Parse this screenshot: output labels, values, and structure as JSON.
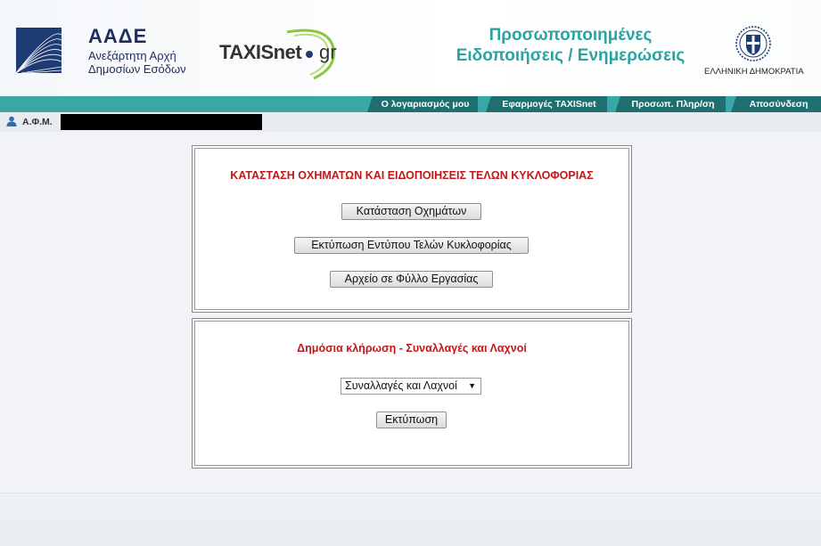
{
  "header": {
    "aade_title": "ΑΑΔΕ",
    "aade_subtitle_line1": "Ανεξάρτητη Αρχή",
    "aade_subtitle_line2": "Δημοσίων Εσόδων",
    "taxisnet_name": "TAXISnet",
    "taxisnet_suffix": "gr",
    "title_line1": "Προσωποποιημένες",
    "title_line2": "Ειδοποιήσεις / Ενημερώσεις",
    "emblem_label": "ΕΛΛΗΝΙΚΗ ΔΗΜΟΚΡΑΤΙΑ",
    "colors": {
      "brand_navy": "#1f3b73",
      "teal": "#2aa3a3",
      "nav_tab": "#1f6e70"
    }
  },
  "nav": {
    "tabs": [
      {
        "label": "Ο λογαριασμός μου"
      },
      {
        "label": "Εφαρμογές TAXISnet"
      },
      {
        "label": "Προσωπ. Πληρ/ση"
      },
      {
        "label": "Αποσύνδεση"
      }
    ]
  },
  "user": {
    "afm_label": "Α.Φ.Μ."
  },
  "vehicles": {
    "title": "ΚΑΤΑΣΤΑΣΗ ΟΧΗΜΑΤΩΝ ΚΑΙ ΕΙΔΟΠΟΙΗΣΕΙΣ ΤΕΛΩΝ ΚΥΚΛΟΦΟΡΙΑΣ",
    "status_button": "Κατάσταση Οχημάτων",
    "print_form_button": "Εκτύπωση Εντύπου Τελών Κυκλοφορίας",
    "spreadsheet_button": "Αρχείο σε Φύλλο Εργασίας",
    "title_color": "#c01818"
  },
  "lottery": {
    "title": "Δημόσια κλήρωση - Συναλλαγές και Λαχνοί",
    "select_value": "Συναλλαγές και Λαχνοί",
    "print_button": "Εκτύπωση"
  }
}
